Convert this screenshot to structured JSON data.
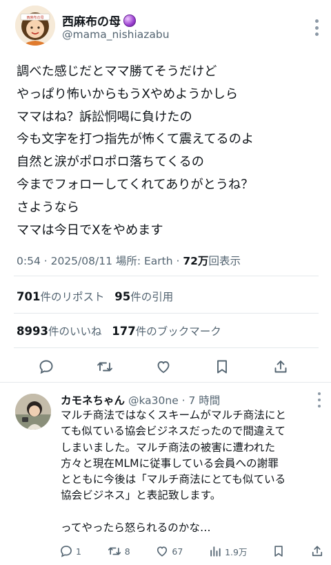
{
  "post": {
    "display_name": "西麻布の母",
    "handle": "@mama_nishiazabu",
    "avatar_badge": "西麻布の母",
    "lines": [
      "調べた感じだとママ勝てそうだけど",
      "やっぱり怖いからもうXやめようかしら",
      "ママはね？訴訟恫喝に負けたの",
      "今も文字を打つ指先が怖くて震えてるのよ",
      "自然と涙がポロポロ落ちてくるの",
      "今までフォローしてくれてありがとうね？",
      "さようなら",
      "ママは今日でXをやめます"
    ],
    "meta": {
      "time_date": "0:54 · 2025/08/11 場所: Earth · ",
      "views_count": "72万",
      "views_label": "回表示"
    },
    "stats": {
      "reposts_count": "701",
      "reposts_label": "件のリポスト",
      "quotes_count": "95",
      "quotes_label": "件の引用",
      "likes_count": "8993",
      "likes_label": "件のいいね",
      "bookmarks_count": "177",
      "bookmarks_label": "件のブックマーク"
    },
    "actions": [
      "reply-icon",
      "repost-icon",
      "like-icon",
      "bookmark-icon",
      "share-icon"
    ]
  },
  "reply": {
    "display_name": "カモネちゃん",
    "handle_time": "@ka30ne · 7 時間",
    "lines": [
      "マルチ商法ではなくスキームがマルチ商法にと",
      "ても似ている協会ビジネスだったので間違えて",
      "しまいました。マルチ商法の被害に遭われた",
      "方々と現在MLMに従事している会員への謝罪",
      "とともに今後は「マルチ商法にとても似ている",
      "協会ビジネス」と表記致します。",
      "",
      "ってやったら怒られるのかな…"
    ],
    "actions": {
      "replies": "1",
      "reposts": "8",
      "likes": "67",
      "views": "1.9万"
    }
  },
  "colors": {
    "text": "#0f1419",
    "secondary": "#536471",
    "divider": "#e4e8eb",
    "orb": "#9b3fd0"
  }
}
